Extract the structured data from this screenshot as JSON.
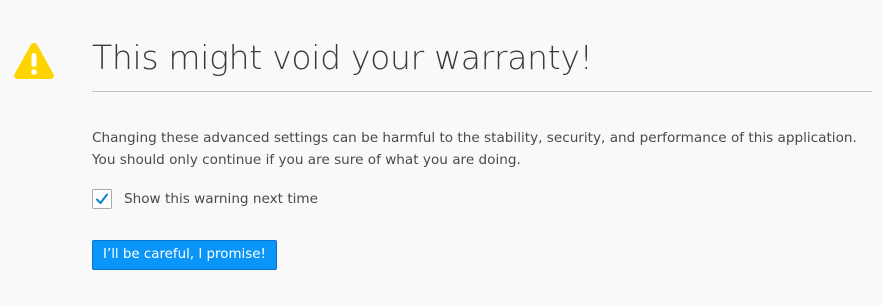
{
  "page": {
    "icon": "warning-triangle-icon",
    "title": "This might void your warranty!",
    "message": "Changing these advanced settings can be harmful to the stability, security, and performance of this application. You should only continue if you are sure of what you are doing.",
    "checkbox": {
      "label": "Show this warning next time",
      "checked": true
    },
    "button_label": "I’ll be careful, I promise!"
  },
  "colors": {
    "warning_yellow": "#ffd400",
    "accent_blue": "#0996f8",
    "check_blue": "#0a84c8"
  }
}
